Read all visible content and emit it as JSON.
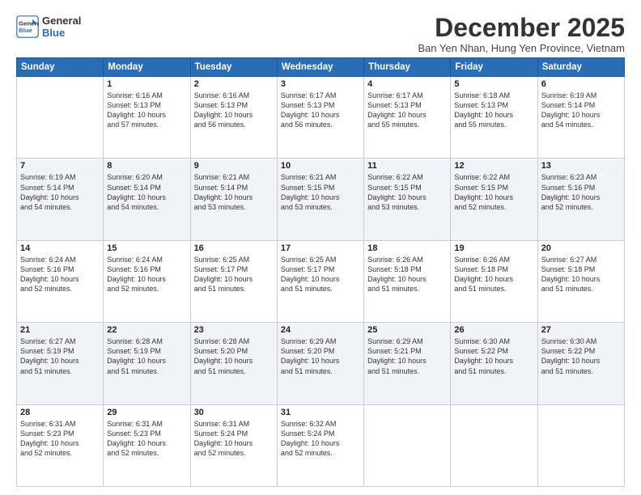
{
  "logo": {
    "line1": "General",
    "line2": "Blue"
  },
  "title": "December 2025",
  "subtitle": "Ban Yen Nhan, Hung Yen Province, Vietnam",
  "headers": [
    "Sunday",
    "Monday",
    "Tuesday",
    "Wednesday",
    "Thursday",
    "Friday",
    "Saturday"
  ],
  "weeks": [
    [
      {
        "day": "",
        "content": ""
      },
      {
        "day": "1",
        "content": "Sunrise: 6:16 AM\nSunset: 5:13 PM\nDaylight: 10 hours\nand 57 minutes."
      },
      {
        "day": "2",
        "content": "Sunrise: 6:16 AM\nSunset: 5:13 PM\nDaylight: 10 hours\nand 56 minutes."
      },
      {
        "day": "3",
        "content": "Sunrise: 6:17 AM\nSunset: 5:13 PM\nDaylight: 10 hours\nand 56 minutes."
      },
      {
        "day": "4",
        "content": "Sunrise: 6:17 AM\nSunset: 5:13 PM\nDaylight: 10 hours\nand 55 minutes."
      },
      {
        "day": "5",
        "content": "Sunrise: 6:18 AM\nSunset: 5:13 PM\nDaylight: 10 hours\nand 55 minutes."
      },
      {
        "day": "6",
        "content": "Sunrise: 6:19 AM\nSunset: 5:14 PM\nDaylight: 10 hours\nand 54 minutes."
      }
    ],
    [
      {
        "day": "7",
        "content": "Sunrise: 6:19 AM\nSunset: 5:14 PM\nDaylight: 10 hours\nand 54 minutes."
      },
      {
        "day": "8",
        "content": "Sunrise: 6:20 AM\nSunset: 5:14 PM\nDaylight: 10 hours\nand 54 minutes."
      },
      {
        "day": "9",
        "content": "Sunrise: 6:21 AM\nSunset: 5:14 PM\nDaylight: 10 hours\nand 53 minutes."
      },
      {
        "day": "10",
        "content": "Sunrise: 6:21 AM\nSunset: 5:15 PM\nDaylight: 10 hours\nand 53 minutes."
      },
      {
        "day": "11",
        "content": "Sunrise: 6:22 AM\nSunset: 5:15 PM\nDaylight: 10 hours\nand 53 minutes."
      },
      {
        "day": "12",
        "content": "Sunrise: 6:22 AM\nSunset: 5:15 PM\nDaylight: 10 hours\nand 52 minutes."
      },
      {
        "day": "13",
        "content": "Sunrise: 6:23 AM\nSunset: 5:16 PM\nDaylight: 10 hours\nand 52 minutes."
      }
    ],
    [
      {
        "day": "14",
        "content": "Sunrise: 6:24 AM\nSunset: 5:16 PM\nDaylight: 10 hours\nand 52 minutes."
      },
      {
        "day": "15",
        "content": "Sunrise: 6:24 AM\nSunset: 5:16 PM\nDaylight: 10 hours\nand 52 minutes."
      },
      {
        "day": "16",
        "content": "Sunrise: 6:25 AM\nSunset: 5:17 PM\nDaylight: 10 hours\nand 51 minutes."
      },
      {
        "day": "17",
        "content": "Sunrise: 6:25 AM\nSunset: 5:17 PM\nDaylight: 10 hours\nand 51 minutes."
      },
      {
        "day": "18",
        "content": "Sunrise: 6:26 AM\nSunset: 5:18 PM\nDaylight: 10 hours\nand 51 minutes."
      },
      {
        "day": "19",
        "content": "Sunrise: 6:26 AM\nSunset: 5:18 PM\nDaylight: 10 hours\nand 51 minutes."
      },
      {
        "day": "20",
        "content": "Sunrise: 6:27 AM\nSunset: 5:18 PM\nDaylight: 10 hours\nand 51 minutes."
      }
    ],
    [
      {
        "day": "21",
        "content": "Sunrise: 6:27 AM\nSunset: 5:19 PM\nDaylight: 10 hours\nand 51 minutes."
      },
      {
        "day": "22",
        "content": "Sunrise: 6:28 AM\nSunset: 5:19 PM\nDaylight: 10 hours\nand 51 minutes."
      },
      {
        "day": "23",
        "content": "Sunrise: 6:28 AM\nSunset: 5:20 PM\nDaylight: 10 hours\nand 51 minutes."
      },
      {
        "day": "24",
        "content": "Sunrise: 6:29 AM\nSunset: 5:20 PM\nDaylight: 10 hours\nand 51 minutes."
      },
      {
        "day": "25",
        "content": "Sunrise: 6:29 AM\nSunset: 5:21 PM\nDaylight: 10 hours\nand 51 minutes."
      },
      {
        "day": "26",
        "content": "Sunrise: 6:30 AM\nSunset: 5:22 PM\nDaylight: 10 hours\nand 51 minutes."
      },
      {
        "day": "27",
        "content": "Sunrise: 6:30 AM\nSunset: 5:22 PM\nDaylight: 10 hours\nand 51 minutes."
      }
    ],
    [
      {
        "day": "28",
        "content": "Sunrise: 6:31 AM\nSunset: 5:23 PM\nDaylight: 10 hours\nand 52 minutes."
      },
      {
        "day": "29",
        "content": "Sunrise: 6:31 AM\nSunset: 5:23 PM\nDaylight: 10 hours\nand 52 minutes."
      },
      {
        "day": "30",
        "content": "Sunrise: 6:31 AM\nSunset: 5:24 PM\nDaylight: 10 hours\nand 52 minutes."
      },
      {
        "day": "31",
        "content": "Sunrise: 6:32 AM\nSunset: 5:24 PM\nDaylight: 10 hours\nand 52 minutes."
      },
      {
        "day": "",
        "content": ""
      },
      {
        "day": "",
        "content": ""
      },
      {
        "day": "",
        "content": ""
      }
    ]
  ]
}
